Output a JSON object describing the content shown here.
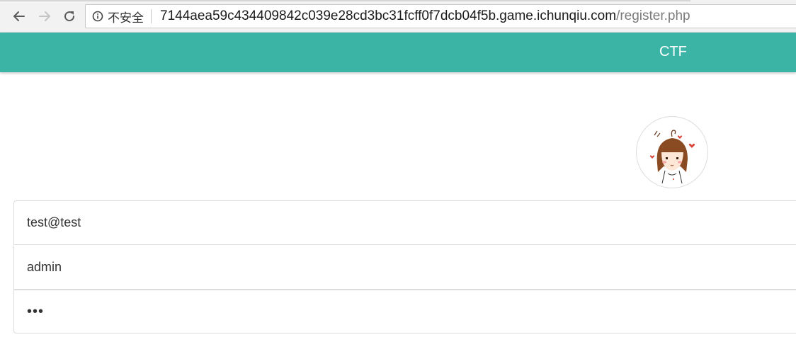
{
  "browser": {
    "security_label": "不安全",
    "url_host": "7144aea59c434409842c039e28cd3bc31fcff0f7dcb04f5b.game.ichunqiu.com",
    "url_path": "/register.php",
    "icons": {
      "back": "arrow-left-icon",
      "forward": "arrow-right-icon",
      "reload": "reload-icon",
      "info": "info-icon"
    }
  },
  "navbar": {
    "brand": "CTF",
    "color": "#3bb4a6"
  },
  "avatar": {
    "image": "cartoon-girl-avatar"
  },
  "form": {
    "email": {
      "value": "test@test",
      "type": "text"
    },
    "username": {
      "value": "admin",
      "type": "text"
    },
    "password": {
      "value": "abc",
      "type": "password"
    }
  }
}
